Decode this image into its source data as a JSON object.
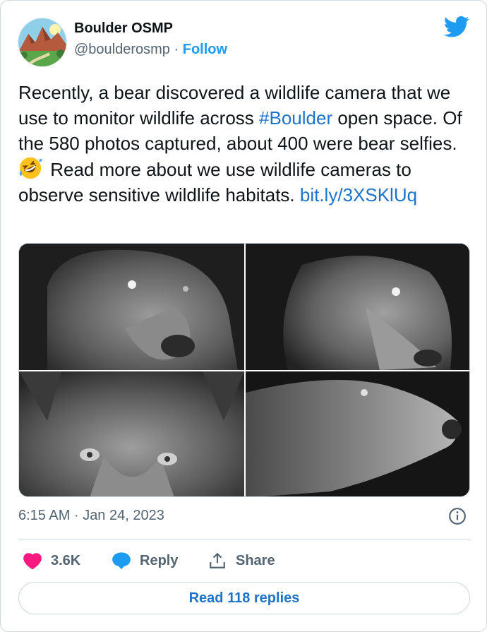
{
  "account": {
    "display_name": "Boulder OSMP",
    "handle": "@boulderosmp",
    "separator": "·",
    "follow_label": "Follow"
  },
  "tweet": {
    "text_part1": "Recently, a bear discovered a wildlife camera that we use to monitor wildlife across ",
    "hashtag": "#Boulder",
    "text_part2": " open space. Of the 580 photos captured, about 400 were bear selfies.",
    "emoji": "rolling-on-floor-laughing-emoji",
    "text_part3": " Read more about we use wildlife cameras to observe sensitive wildlife habitats. ",
    "link": "bit.ly/3XSKlUq"
  },
  "meta": {
    "time": "6:15 AM",
    "separator": "·",
    "date": "Jan 24, 2023"
  },
  "actions": {
    "like_count": "3.6K",
    "reply_label": "Reply",
    "share_label": "Share"
  },
  "read_replies_label": "Read 118 replies",
  "colors": {
    "link_blue": "#1d73c9",
    "twitter_blue": "#1d9bf0",
    "like_pink": "#f91880",
    "secondary_text": "#536471"
  }
}
